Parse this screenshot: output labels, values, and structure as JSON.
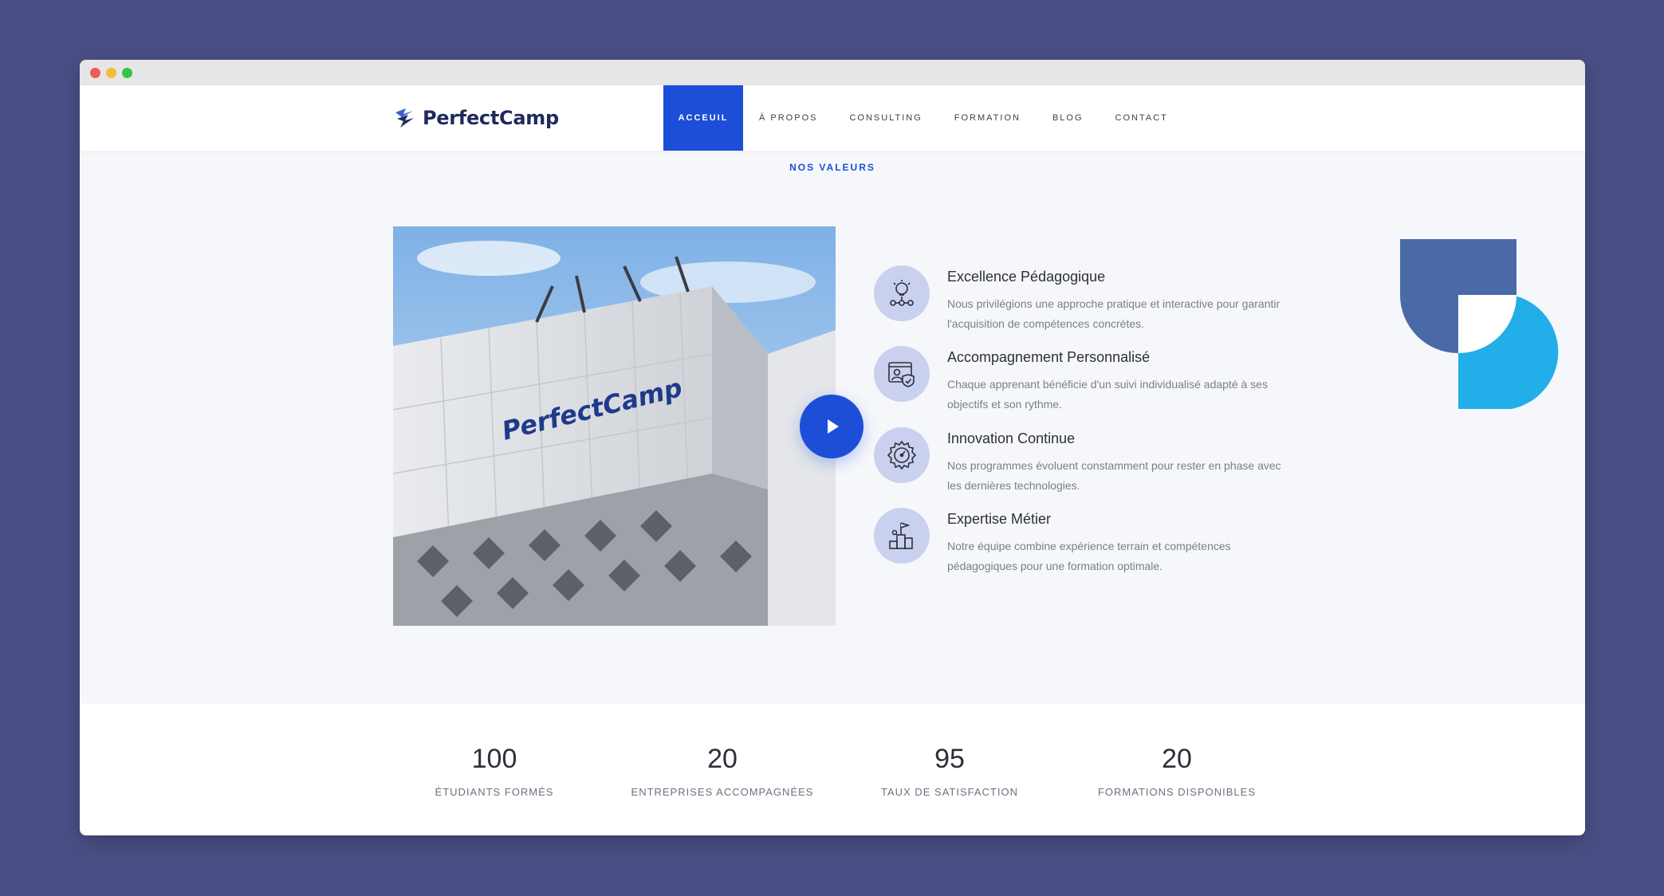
{
  "brand": {
    "name": "PerfectCamp"
  },
  "nav": {
    "items": [
      {
        "label": "ACCEUIL",
        "active": true
      },
      {
        "label": "À PROPOS"
      },
      {
        "label": "CONSULTING"
      },
      {
        "label": "FORMATION"
      },
      {
        "label": "BLOG"
      },
      {
        "label": "CONTACT"
      }
    ]
  },
  "section": {
    "label": "NOS VALEURS"
  },
  "hero": {
    "sign_text": "PerfectCamp"
  },
  "values": [
    {
      "title": "Excellence Pédagogique",
      "description": "Nous privilégions une approche pratique et interactive pour garantir l'acquisition de compétences concrètes.",
      "icon": "lightbulb-network-icon"
    },
    {
      "title": "Accompagnement Personnalisé",
      "description": "Chaque apprenant bénéficie d'un suivi individualisé adapté à ses objectifs et son rythme.",
      "icon": "user-shield-icon"
    },
    {
      "title": "Innovation Continue",
      "description": "Nos programmes évoluent constamment pour rester en phase avec les dernières technologies.",
      "icon": "gear-gauge-icon"
    },
    {
      "title": "Expertise Métier",
      "description": "Notre équipe combine expérience terrain et compétences pédagogiques pour une formation optimale.",
      "icon": "podium-flag-icon"
    }
  ],
  "stats": [
    {
      "value": "100",
      "label": "ÉTUDIANTS FORMÉS"
    },
    {
      "value": "20",
      "label": "ENTREPRISES ACCOMPAGNÉES"
    },
    {
      "value": "95",
      "label": "TAUX DE SATISFACTION"
    },
    {
      "value": "20",
      "label": "FORMATIONS DISPONIBLES"
    }
  ],
  "colors": {
    "accent": "#1c4ed8",
    "page_background": "#4a5087",
    "deco_dark": "#4a6aa7",
    "deco_light": "#22aee8"
  }
}
